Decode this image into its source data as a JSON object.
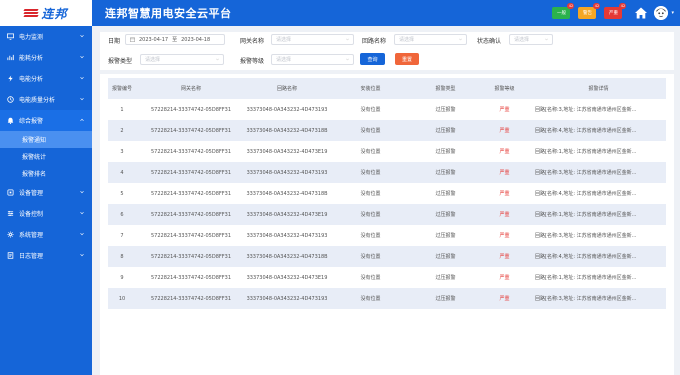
{
  "header": {
    "title": "连邦智慧用电安全云平台",
    "logo_text": "连邦",
    "alarm_levels": [
      {
        "label": "一般",
        "count": "42",
        "color": "#2bb24c"
      },
      {
        "label": "警告",
        "count": "42",
        "color": "#f5a623"
      },
      {
        "label": "严重",
        "count": "42",
        "color": "#e53935"
      }
    ]
  },
  "sidebar": {
    "items": [
      {
        "label": "电力监测",
        "icon": "monitor-icon"
      },
      {
        "label": "能耗分析",
        "icon": "chart-icon"
      },
      {
        "label": "电能分析",
        "icon": "bolt-icon"
      },
      {
        "label": "电能质量分析",
        "icon": "quality-icon"
      },
      {
        "label": "综合报警",
        "icon": "alarm-icon"
      },
      {
        "label": "设备管理",
        "icon": "device-icon"
      },
      {
        "label": "设备控制",
        "icon": "control-icon"
      },
      {
        "label": "系统管理",
        "icon": "system-icon"
      },
      {
        "label": "日志管理",
        "icon": "log-icon"
      }
    ],
    "sub_items": [
      "报警通知",
      "报警统计",
      "报警排名"
    ]
  },
  "filters": {
    "date_label": "日期",
    "date_start": "2023-04-17",
    "date_sep": "至",
    "date_end": "2023-04-18",
    "gateway_label": "网关名称",
    "gateway_placeholder": "请选择",
    "loop_label": "回路名称",
    "loop_placeholder": "请选择",
    "status_label": "状态确认",
    "status_placeholder": "请选择",
    "type_label": "报警类型",
    "type_placeholder": "请选择",
    "level_label": "报警等级",
    "level_placeholder": "请选择",
    "query_button": "查询",
    "reset_button": "重置"
  },
  "table": {
    "columns": [
      "报警编号",
      "网关名称",
      "回路名称",
      "安装位置",
      "报警类型",
      "报警等级",
      "报警详情"
    ],
    "rows": [
      [
        "1",
        "57228214-33374742-05D8FF31",
        "33373048-0A343232-4D473193",
        "没有位置",
        "过压报警",
        "严重",
        "回路[名称:3,地址: 江苏省南通市通州区金新..."
      ],
      [
        "2",
        "57228214-33374742-05D8FF31",
        "33373048-0A343232-4D47318B",
        "没有位置",
        "过压报警",
        "严重",
        "回路[名称:4,地址: 江苏省南通市通州区金新..."
      ],
      [
        "3",
        "57228214-33374742-05D8FF31",
        "33373048-0A343232-4D473E19",
        "没有位置",
        "过压报警",
        "严重",
        "回路[名称:1,地址: 江苏省南通市通州区金新..."
      ],
      [
        "4",
        "57228214-33374742-05D8FF31",
        "33373048-0A343232-4D473193",
        "没有位置",
        "过压报警",
        "严重",
        "回路[名称:3,地址: 江苏省南通市通州区金新..."
      ],
      [
        "5",
        "57228214-33374742-05D8FF31",
        "33373048-0A343232-4D47318B",
        "没有位置",
        "过压报警",
        "严重",
        "回路[名称:4,地址: 江苏省南通市通州区金新..."
      ],
      [
        "6",
        "57228214-33374742-05D8FF31",
        "33373048-0A343232-4D473E19",
        "没有位置",
        "过压报警",
        "严重",
        "回路[名称:1,地址: 江苏省南通市通州区金新..."
      ],
      [
        "7",
        "57228214-33374742-05D8FF31",
        "33373048-0A343232-4D473193",
        "没有位置",
        "过压报警",
        "严重",
        "回路[名称:3,地址: 江苏省南通市通州区金新..."
      ],
      [
        "8",
        "57228214-33374742-05D8FF31",
        "33373048-0A343232-4D47318B",
        "没有位置",
        "过压报警",
        "严重",
        "回路[名称:4,地址: 江苏省南通市通州区金新..."
      ],
      [
        "9",
        "57228214-33374742-05D8FF31",
        "33373048-0A343232-4D473E19",
        "没有位置",
        "过压报警",
        "严重",
        "回路[名称:1,地址: 江苏省南通市通州区金新..."
      ],
      [
        "10",
        "57228214-33374742-05D8FF31",
        "33373048-0A343232-4D473193",
        "没有位置",
        "过压报警",
        "严重",
        "回路[名称:3,地址: 江苏省南通市通州区金新..."
      ]
    ]
  },
  "colors": {
    "primary": "#1565d8",
    "danger": "#e53935",
    "reset_button": "#f0663a"
  }
}
